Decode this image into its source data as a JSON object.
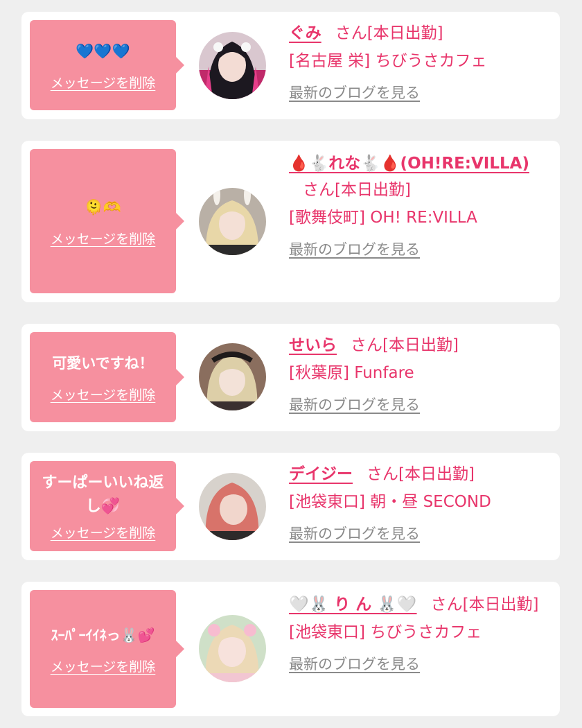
{
  "colors": {
    "background": "#efefef",
    "card": "#ffffff",
    "bubble": "#f6909f",
    "accent": "#e8356b",
    "link_gray": "#8a8a8a"
  },
  "actions": {
    "delete_message_label": "メッセージを削除",
    "view_blog_label": "最新のブログを見る"
  },
  "items": [
    {
      "message": "💙💙💙",
      "name": "ぐみ",
      "honorific": "さん[本日出勤]",
      "shop": "[名古屋 栄] ちびうさカフェ"
    },
    {
      "message": "🫠🫶",
      "name": "🩸🐇れな🐇🩸(OH!RE:VILLA)",
      "honorific": "さん[本日出勤]",
      "shop": "[歌舞伎町] OH! RE:VILLA"
    },
    {
      "message": "可愛いですね！",
      "name": "せいら",
      "honorific": "さん[本日出勤]",
      "shop": "[秋葉原] Funfare"
    },
    {
      "message": "すーぱーいいね返し💞",
      "name": "デイジー",
      "honorific": "さん[本日出勤]",
      "shop": "[池袋東口] 朝・昼 SECOND"
    },
    {
      "message": "ｽｰﾊﾟｰｲｲﾈっ🐰💕",
      "name": "🤍🐰 り ん 🐰🤍",
      "honorific": "さん[本日出勤]",
      "shop": "[池袋東口] ちびうさカフェ"
    }
  ]
}
